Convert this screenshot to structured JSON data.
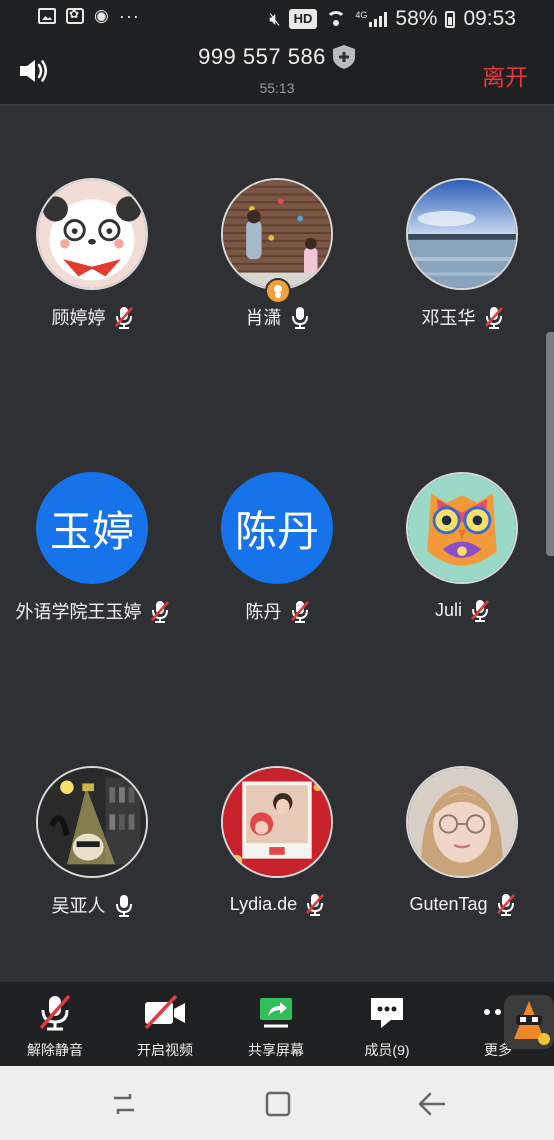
{
  "status_bar": {
    "battery_percent": "58%",
    "time": "09:53",
    "hd_label": "HD",
    "network_label": "4G",
    "overflow_dots": "···"
  },
  "header": {
    "meeting_id": "999 557 586",
    "duration": "55:13",
    "leave_label": "离开"
  },
  "participants": [
    {
      "name": "顾婷婷",
      "mic": "muted",
      "avatar": "panda"
    },
    {
      "name": "肖潇",
      "mic": "on",
      "avatar": "climbing-photo",
      "host": true
    },
    {
      "name": "邓玉华",
      "mic": "muted",
      "avatar": "lake-photo"
    },
    {
      "name": "外语学院王玉婷",
      "mic": "muted",
      "initials": "玉婷"
    },
    {
      "name": "陈丹",
      "mic": "muted",
      "initials": "陈丹"
    },
    {
      "name": "Juli",
      "mic": "muted",
      "avatar": "owl-art"
    },
    {
      "name": "吴亚人",
      "mic": "on",
      "avatar": "lamp-art"
    },
    {
      "name": "Lydia.de",
      "mic": "muted",
      "avatar": "photo-frame"
    },
    {
      "name": "GutenTag",
      "mic": "muted",
      "avatar": "portrait-photo"
    }
  ],
  "toolbar": {
    "unmute_label": "解除静音",
    "video_label": "开启视频",
    "share_label": "共享屏幕",
    "members_label": "成员(9)",
    "more_label": "更多"
  },
  "colors": {
    "background": "#2f3033",
    "bar": "#1f2022",
    "accent_blue": "#1673ea",
    "leave_red": "#e0393e",
    "share_green": "#2fbe5a",
    "muted_red": "#e0393e"
  }
}
